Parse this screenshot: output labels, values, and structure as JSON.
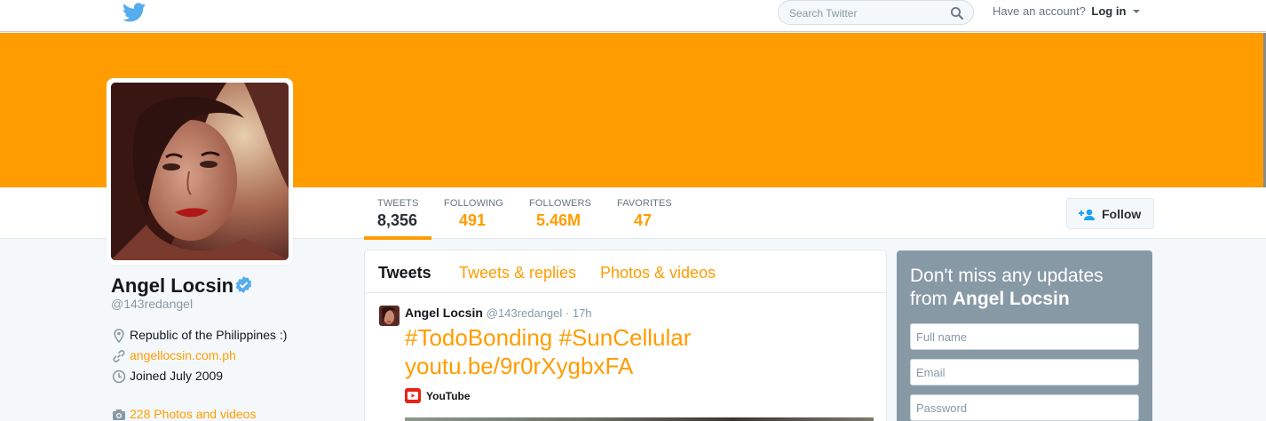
{
  "header": {
    "logo_icon": "twitter-bird-icon",
    "search_placeholder": "Search Twitter",
    "account_prompt": "Have an account?",
    "login_label": "Log in"
  },
  "colors": {
    "accent": "#ff9c00",
    "banner": "#ff9c00",
    "text": "#14171a",
    "muted": "#8899a6",
    "signup_bg": "#8899a6"
  },
  "profile": {
    "name": "Angel Locsin",
    "handle": "@143redangel",
    "verified_icon": "verified-badge-icon",
    "location": "Republic of the Philippines :)",
    "website": "angellocsin.com.ph",
    "joined": "Joined July 2009",
    "photos_link": "228 Photos and videos"
  },
  "stats": [
    {
      "label": "TWEETS",
      "value": "8,356",
      "active": true
    },
    {
      "label": "FOLLOWING",
      "value": "491"
    },
    {
      "label": "FOLLOWERS",
      "value": "5.46M"
    },
    {
      "label": "FAVORITES",
      "value": "47"
    }
  ],
  "follow_label": "Follow",
  "timeline": {
    "tabs": [
      "Tweets",
      "Tweets & replies",
      "Photos & videos"
    ],
    "tweet": {
      "author": "Angel Locsin",
      "meta": "@143redangel · 17h",
      "line1": "#TodoBonding #SunCellular",
      "line2": "youtu.be/9r0rXygbxFA",
      "card_source": "YouTube"
    }
  },
  "signup": {
    "title_prefix": "Don't miss any updates from",
    "title_name": "Angel Locsin",
    "fullname_placeholder": "Full name",
    "email_placeholder": "Email",
    "password_placeholder": "Password"
  }
}
